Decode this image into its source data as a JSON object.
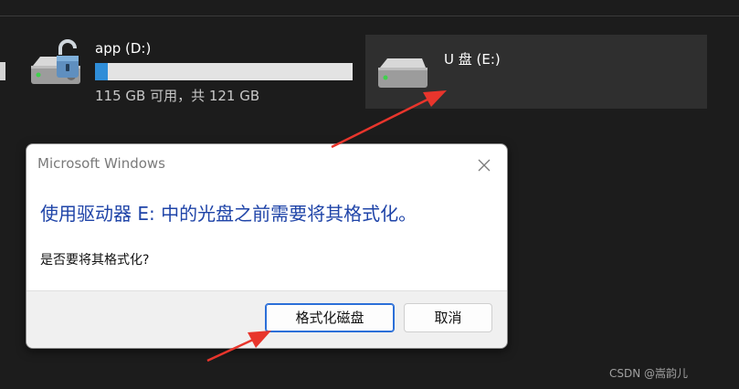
{
  "drives": [
    {
      "name": "app (D:)",
      "capacity_text": "115 GB 可用，共 121 GB",
      "used_fraction": 0.05,
      "icon": "hdd-drive-icon",
      "overlay_icon": "unlock-icon"
    },
    {
      "name": "U 盘 (E:)",
      "icon": "usb-drive-icon",
      "selected": true
    }
  ],
  "dialog": {
    "title": "Microsoft Windows",
    "heading": "使用驱动器 E: 中的光盘之前需要将其格式化。",
    "body": "是否要将其格式化?",
    "buttons": {
      "format": "格式化磁盘",
      "cancel": "取消"
    },
    "close_icon": "close-icon"
  },
  "colors": {
    "background": "#1c1c1c",
    "selected_tile": "#2f2f2f",
    "capacity_fill": "#2f8dd8",
    "dialog_heading": "#1f44a8",
    "annotation_arrow": "#e8352c"
  },
  "watermark": "CSDN @嵩韵儿"
}
